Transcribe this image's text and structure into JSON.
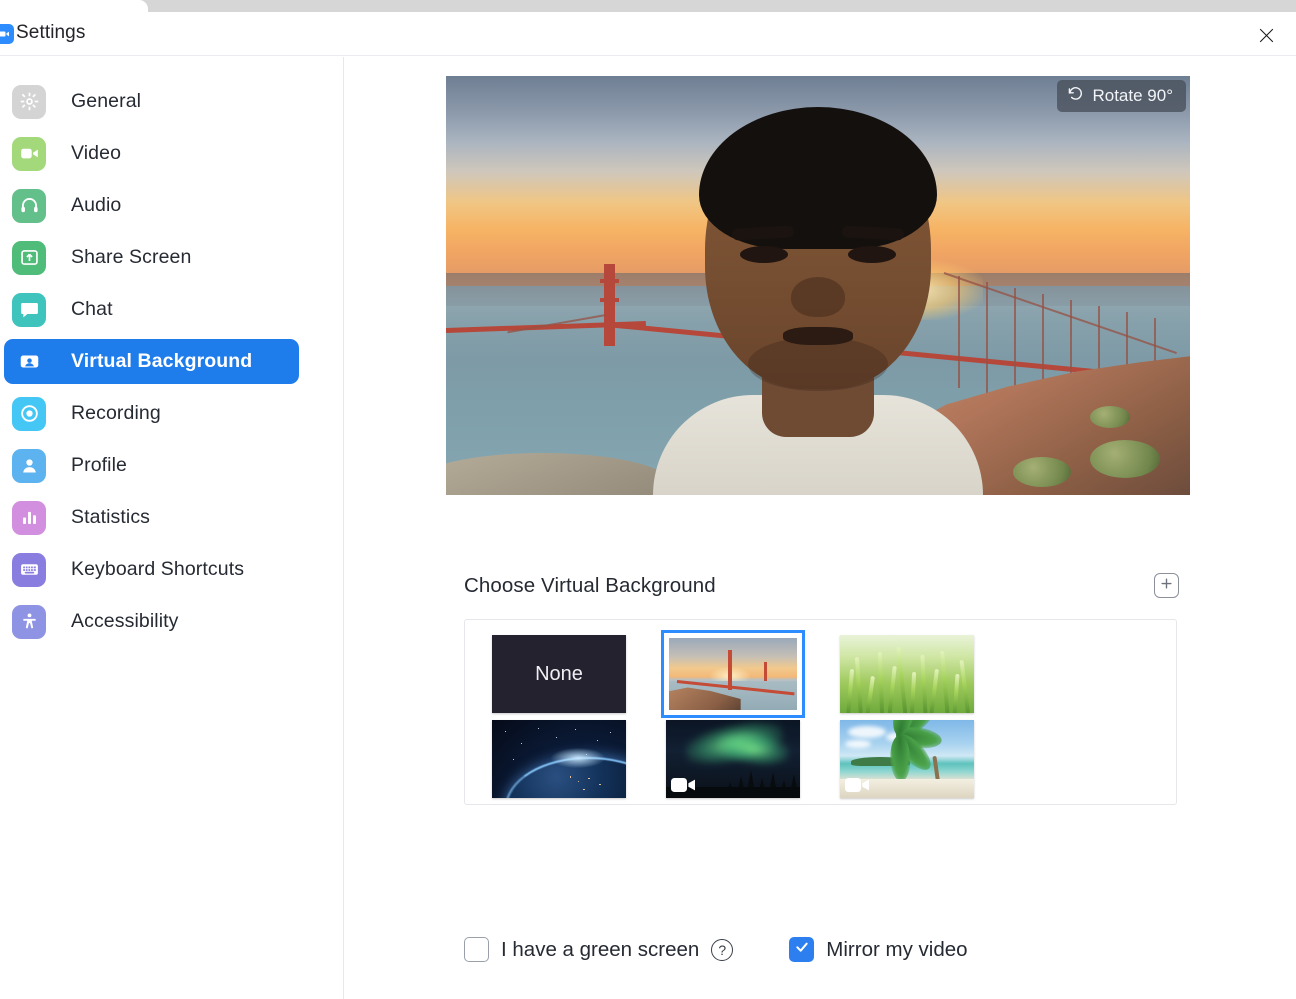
{
  "window": {
    "title": "Settings",
    "app_icon": "zoom-icon",
    "close_icon": "close-icon"
  },
  "sidebar": {
    "items": [
      {
        "label": "General",
        "icon": "gear-icon",
        "color": "#d4d4d4",
        "active": false
      },
      {
        "label": "Video",
        "icon": "video-icon",
        "color": "#a4d97b",
        "active": false
      },
      {
        "label": "Audio",
        "icon": "headset-icon",
        "color": "#63c08a",
        "active": false
      },
      {
        "label": "Share Screen",
        "icon": "upload-icon",
        "color": "#4fbc79",
        "active": false
      },
      {
        "label": "Chat",
        "icon": "chat-icon",
        "color": "#3fc3bd",
        "active": false
      },
      {
        "label": "Virtual Background",
        "icon": "person-card-icon",
        "color": "#ffffff",
        "active": true
      },
      {
        "label": "Recording",
        "icon": "record-icon",
        "color": "#45c7f5",
        "active": false
      },
      {
        "label": "Profile",
        "icon": "person-icon",
        "color": "#5cb3f0",
        "active": false
      },
      {
        "label": "Statistics",
        "icon": "bar-chart-icon",
        "color": "#d28fe0",
        "active": false
      },
      {
        "label": "Keyboard Shortcuts",
        "icon": "keyboard-icon",
        "color": "#8a7de0",
        "active": false
      },
      {
        "label": "Accessibility",
        "icon": "accessibility-icon",
        "color": "#8f93e4",
        "active": false
      }
    ],
    "active_color": "#1f7ceb"
  },
  "preview": {
    "rotate_button_label": "Rotate 90°",
    "rotate_icon": "rotate-ccw-icon",
    "background_name": "Golden Gate Bridge"
  },
  "backgrounds": {
    "section_title": "Choose Virtual Background",
    "add_button_icon": "plus-icon",
    "selected_index": 1,
    "items": [
      {
        "label": "None",
        "kind": "none",
        "is_video": false,
        "selected": false
      },
      {
        "label": "Golden Gate Bridge",
        "kind": "bridge",
        "is_video": false,
        "selected": true
      },
      {
        "label": "Grass",
        "kind": "grass",
        "is_video": false,
        "selected": false
      },
      {
        "label": "Earth from Space",
        "kind": "earth",
        "is_video": false,
        "selected": false
      },
      {
        "label": "Aurora",
        "kind": "aurora",
        "is_video": true,
        "selected": false
      },
      {
        "label": "Beach",
        "kind": "beach",
        "is_video": true,
        "selected": false
      }
    ]
  },
  "options": {
    "green_screen": {
      "label": "I have a green screen",
      "checked": false,
      "help_icon": "question-icon",
      "help_glyph": "?"
    },
    "mirror_video": {
      "label": "Mirror my video",
      "checked": true,
      "check_icon": "check-icon"
    }
  },
  "colors": {
    "accent": "#2D8CFF",
    "active_nav": "#1f7ceb",
    "text": "#262a33",
    "panel_border": "#e6e6ec"
  }
}
